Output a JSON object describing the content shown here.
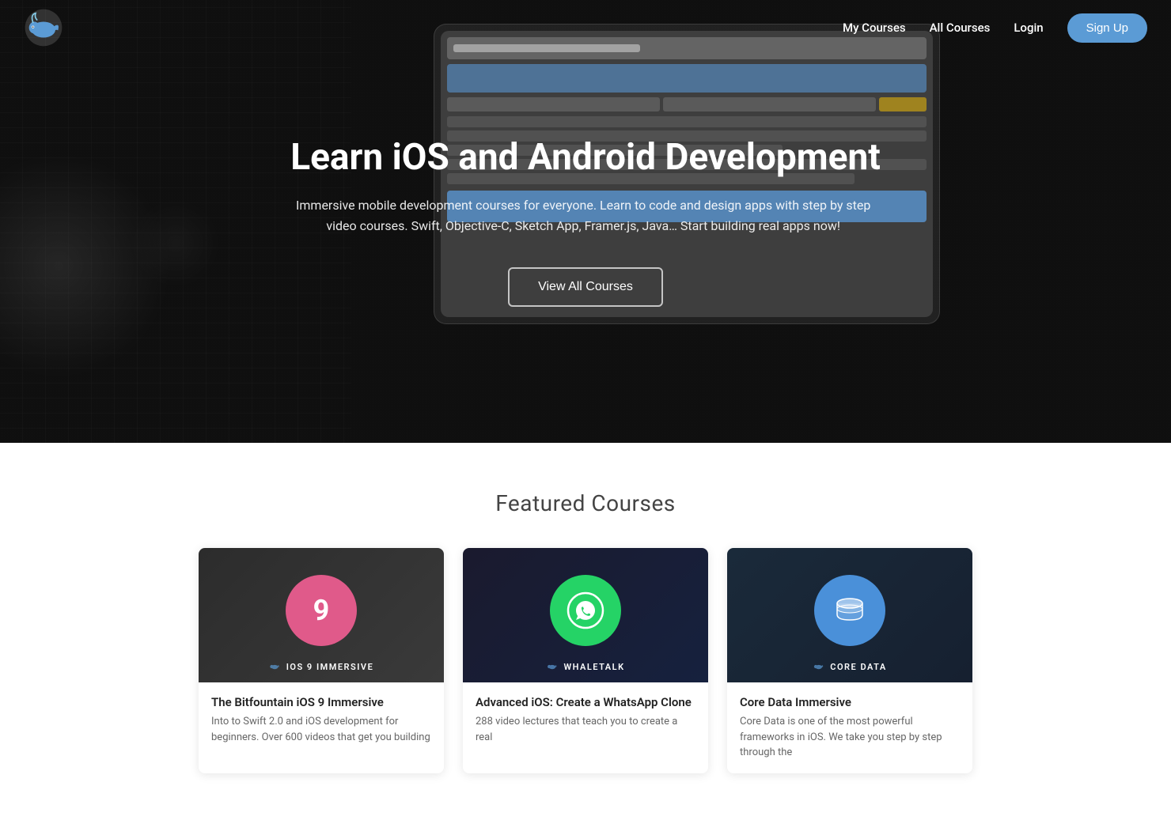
{
  "nav": {
    "logo_alt": "Whale Logo",
    "links": [
      {
        "label": "My Courses",
        "id": "my-courses"
      },
      {
        "label": "All Courses",
        "id": "all-courses"
      },
      {
        "label": "Login",
        "id": "login"
      }
    ],
    "signup_label": "Sign Up"
  },
  "hero": {
    "title": "Learn iOS and Android Development",
    "subtitle": "Immersive mobile development courses for everyone. Learn to code and design apps with step by step video courses. Swift, Objective-C, Sketch App, Framer.js, Java… Start building real apps now!",
    "cta_label": "View All Courses"
  },
  "featured": {
    "section_title": "Featured Courses",
    "courses": [
      {
        "id": "ios9",
        "banner_label": "iOS 9 IMMERSIVE",
        "icon_text": "9",
        "icon_style": "ios",
        "title": "The Bitfountain iOS 9 Immersive",
        "description": "Into to Swift 2.0 and iOS development for beginners. Over 600 videos that get you building"
      },
      {
        "id": "whatsapp",
        "banner_label": "WHALETALK",
        "icon_text": "💬",
        "icon_style": "whatsapp",
        "title": "Advanced iOS: Create a WhatsApp Clone",
        "description": "288 video lectures that teach you to create a real"
      },
      {
        "id": "coredata",
        "banner_label": "CORE DATA",
        "icon_text": "🗄",
        "icon_style": "coredata",
        "title": "Core Data Immersive",
        "description": "Core Data is one of the most powerful frameworks in iOS. We take you step by step through the"
      }
    ]
  },
  "colors": {
    "accent_blue": "#5b9bd5",
    "hero_overlay": "rgba(0,0,0,0.55)",
    "ios_pink": "#e05a8a",
    "whatsapp_green": "#25d366",
    "coredata_blue": "#4a90d9"
  }
}
